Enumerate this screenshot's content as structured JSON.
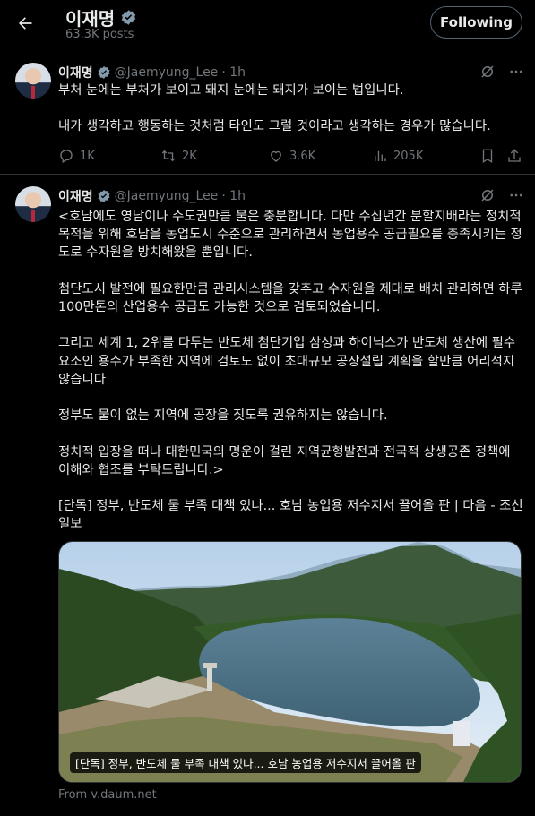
{
  "header": {
    "name": "이재명",
    "posts": "63.3K posts",
    "follow_label": "Following"
  },
  "tweets": [
    {
      "name": "이재명",
      "handle": "@Jaemyung_Lee",
      "time": "· 1h",
      "text": "부처 눈에는 부처가 보이고 돼지 눈에는 돼지가 보이는 법입니다.\n\n내가 생각하고 행동하는 것처럼 타인도 그럴 것이라고 생각하는 경우가 많습니다.",
      "replies": "1K",
      "reposts": "2K",
      "likes": "3.6K",
      "views": "205K"
    },
    {
      "name": "이재명",
      "handle": "@Jaemyung_Lee",
      "time": "· 1h",
      "text": "<호남에도 영남이나 수도권만큼 물은 충분합니다. 다만 수십년간 분할지배라는 정치적 목적을 위해 호남을 농업도시 수준으로 관리하면서 농업용수 공급필요를 충족시키는 정도로 수자원을 방치해왔을 뿐입니다.\n\n첨단도시 발전에 필요한만큼 관리시스템을 갖추고 수자원을 제대로 배치 관리하면 하루 100만톤의 산업용수 공급도 가능한 것으로 검토되었습니다.\n\n그리고 세계 1, 2위를 다투는 반도체 첨단기업 삼성과 하이닉스가 반도체 생산에 필수요소인 용수가 부족한 지역에 검토도 없이 초대규모 공장설립 계획을 할만큼 어리석지 않습니다\n\n정부도 물이 없는 지역에 공장을 짓도록 권유하지는 않습니다.\n\n정치적 입장을 떠나 대한민국의 명운이 걸린 지역균형발전과 전국적 상생공존 정책에 이해와 협조를 부탁드립니다.>\n\n[단독] 정부, 반도체 물 부족 대책 있나... 호남 농업용 저수지서 끌어올 판 | 다음 - 조선일보",
      "card_caption": "[단독] 정부, 반도체 물 부족 대책 있나... 호남 농업용 저수지서 끌어올 판",
      "card_source": "From v.daum.net"
    }
  ],
  "colors": {
    "background": "#000000",
    "text": "#e7e9ea",
    "muted": "#71767b",
    "verified": "#829aab",
    "border": "#2f3336"
  }
}
